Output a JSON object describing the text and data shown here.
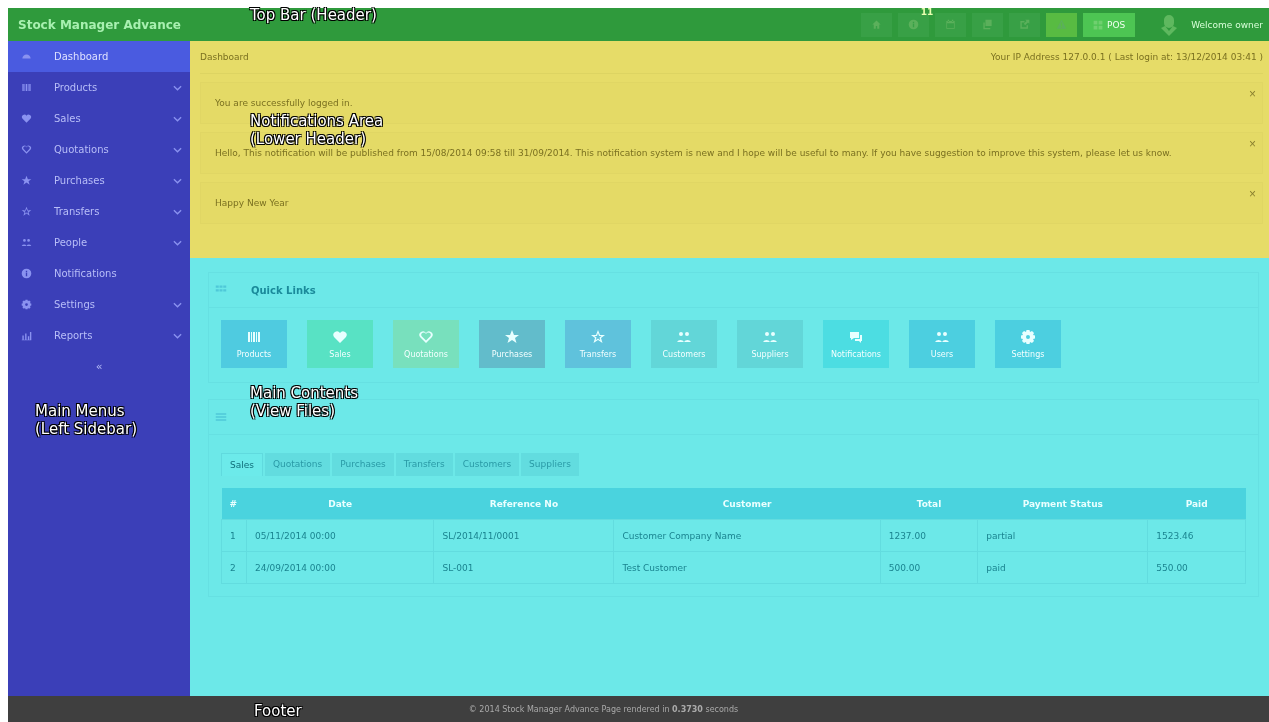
{
  "top_bar": {
    "brand": "Stock Manager Advance",
    "buttons": [
      {
        "kind": "home"
      },
      {
        "kind": "info",
        "badge": "11"
      },
      {
        "kind": "calendar"
      },
      {
        "kind": "copy"
      },
      {
        "kind": "share"
      },
      {
        "kind": "warning"
      }
    ],
    "pos_button": "POS",
    "welcome": "Welcome owner"
  },
  "sidebar": {
    "items": [
      {
        "label": "Dashboard",
        "selected": true,
        "expandable": false
      },
      {
        "label": "Products",
        "selected": false,
        "expandable": true
      },
      {
        "label": "Sales",
        "selected": false,
        "expandable": true
      },
      {
        "label": "Quotations",
        "selected": false,
        "expandable": true
      },
      {
        "label": "Purchases",
        "selected": false,
        "expandable": true
      },
      {
        "label": "Transfers",
        "selected": false,
        "expandable": true
      },
      {
        "label": "People",
        "selected": false,
        "expandable": true
      },
      {
        "label": "Notifications",
        "selected": false,
        "expandable": false
      },
      {
        "label": "Settings",
        "selected": false,
        "expandable": true
      },
      {
        "label": "Reports",
        "selected": false,
        "expandable": true
      }
    ],
    "collapse": "«"
  },
  "breadcrumb": "Dashboard",
  "ip_info": "Your IP Address 127.0.0.1 ( Last login at: 13/12/2014 03:41 )",
  "notifications": [
    {
      "text": "You are successfully logged in.",
      "close": "×"
    },
    {
      "text": "Hello, This notification will be published from 15/08/2014 09:58 till 31/09/2014. This notification system is new and I hope will be useful to many. If you have suggestion to improve this system, please let us know.",
      "close": "×"
    },
    {
      "text": "Happy New Year",
      "close": "×"
    }
  ],
  "quick_links": {
    "title": "Quick Links",
    "items": [
      {
        "label": "Products",
        "color": "#4fcbe0"
      },
      {
        "label": "Sales",
        "color": "#58e2c4"
      },
      {
        "label": "Quotations",
        "color": "#78e0bd"
      },
      {
        "label": "Purchases",
        "color": "#62bccb"
      },
      {
        "label": "Transfers",
        "color": "#5fc2dc"
      },
      {
        "label": "Customers",
        "color": "#62d6d8"
      },
      {
        "label": "Suppliers",
        "color": "#62d6d8"
      },
      {
        "label": "Notifications",
        "color": "#4cdde2"
      },
      {
        "label": "Users",
        "color": "#4ccfe0"
      },
      {
        "label": "Settings",
        "color": "#4ccfe0"
      }
    ]
  },
  "latest": {
    "tabs": [
      {
        "label": "Sales",
        "selected": true
      },
      {
        "label": "Quotations",
        "selected": false
      },
      {
        "label": "Purchases",
        "selected": false
      },
      {
        "label": "Transfers",
        "selected": false
      },
      {
        "label": "Customers",
        "selected": false
      },
      {
        "label": "Suppliers",
        "selected": false
      }
    ],
    "table": {
      "columns": [
        "#",
        "Date",
        "Reference No",
        "Customer",
        "Total",
        "Payment Status",
        "Paid"
      ],
      "rows": [
        [
          "1",
          "05/11/2014 00:00",
          "SL/2014/11/0001",
          "Customer Company Name",
          "1237.00",
          "partial",
          "1523.46"
        ],
        [
          "2",
          "24/09/2014 00:00",
          "SL-001",
          "Test Customer",
          "500.00",
          "paid",
          "550.00"
        ]
      ]
    }
  },
  "footer": "© 2014 Stock Manager Advance Page rendered in **0.3730** seconds",
  "annotations": [
    {
      "text": "Top Bar (Header)"
    },
    {
      "text": "Notifications Area\n(Lower Header)"
    },
    {
      "text": "Main Contents\n(View Files)"
    },
    {
      "text": "Main Menus\n(Left Sidebar)"
    },
    {
      "text": "Footer"
    }
  ]
}
